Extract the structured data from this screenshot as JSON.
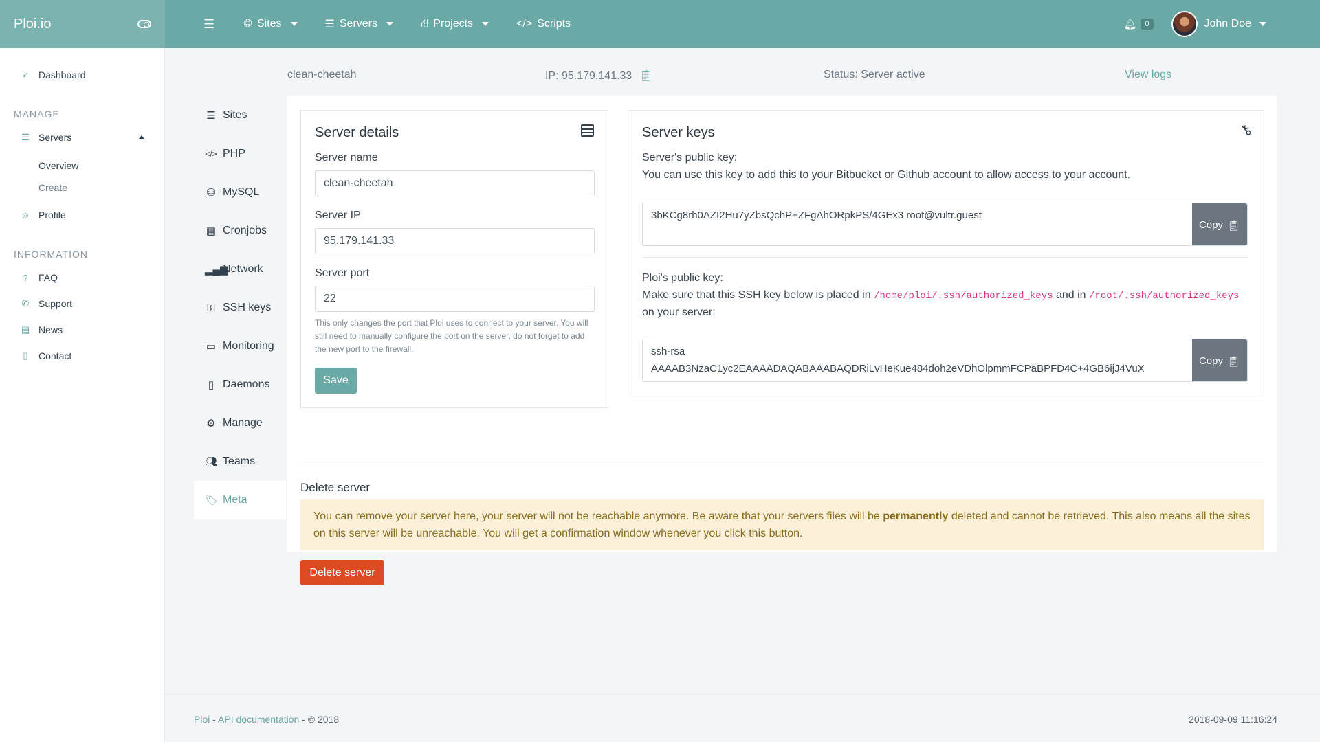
{
  "brand": {
    "name": "Ploi.io"
  },
  "nav": {
    "items": [
      {
        "label": "Sites",
        "icon": "globe-icon"
      },
      {
        "label": "Servers",
        "icon": "server-icon"
      },
      {
        "label": "Projects",
        "icon": "sitemap-icon"
      },
      {
        "label": "Scripts",
        "icon": "code-icon"
      }
    ],
    "notifications": "0",
    "user": "John Doe"
  },
  "sidebar": {
    "dashboard": "Dashboard",
    "manage_heading": "MANAGE",
    "servers": "Servers",
    "overview": "Overview",
    "create": "Create",
    "profile": "Profile",
    "information_heading": "INFORMATION",
    "faq": "FAQ",
    "support": "Support",
    "news": "News",
    "contact": "Contact"
  },
  "infobar": {
    "name": "clean-cheetah",
    "ip": "IP: 95.179.141.33",
    "status": "Status: Server active",
    "logs": "View logs"
  },
  "subnav": [
    "Sites",
    "PHP",
    "MySQL",
    "Cronjobs",
    "Network",
    "SSH keys",
    "Monitoring",
    "Daemons",
    "Manage",
    "Teams",
    "Meta"
  ],
  "server_details": {
    "title": "Server details",
    "name_label": "Server name",
    "name_value": "clean-cheetah",
    "ip_label": "Server IP",
    "ip_value": "95.179.141.33",
    "port_label": "Server port",
    "port_value": "22",
    "help": "This only changes the port that Ploi uses to connect to your server. You will still need to manually configure the port on the server, do not forget to add the new port to the firewall.",
    "save": "Save"
  },
  "server_keys": {
    "title": "Server keys",
    "public_label": "Server's public key:",
    "public_desc": "You can use this key to add this to your Bitbucket or Github account to allow access to your account.",
    "public_key": "3bKCg8rh0AZI2Hu7yZbsQchP+ZFgAhORpkPS/4GEx3 root@vultr.guest",
    "copy": "Copy",
    "ploi_label": "Ploi's public key:",
    "ploi_desc_1": "Make sure that this SSH key below is placed in",
    "path_1": "/home/ploi/.ssh/authorized_keys",
    "and_in": "and in",
    "path_2": "/root/.ssh/authorized_keys",
    "ploi_desc_2": "on your server:",
    "ploi_key_1": "ssh-rsa",
    "ploi_key_2": "AAAAB3NzaC1yc2EAAAADAQABAAABAQDRiLvHeKue484doh2eVDhOlpmmFCPaBPFD4C+4GB6ijJ4VuX"
  },
  "delete": {
    "title": "Delete server",
    "alert_1": "You can remove your server here, your server will not be reachable anymore. Be aware that your servers files will be",
    "alert_strong": "permanently",
    "alert_2": "deleted and cannot be retrieved. This also means all the sites on this server will be unreachable. You will get a confirmation window whenever you click this button.",
    "button": "Delete server"
  },
  "footer": {
    "ploi": "Ploi",
    "sep": " - ",
    "api": "API documentation",
    "copy": " - © 2018",
    "timestamp": "2018-09-09 11:16:24"
  }
}
